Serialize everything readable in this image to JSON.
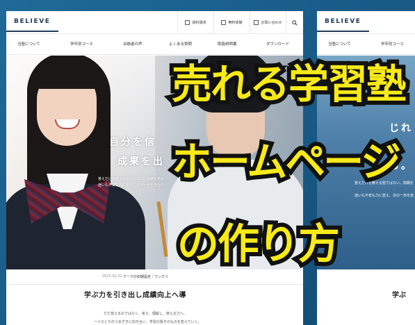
{
  "brand": {
    "logo": "BELIEVE"
  },
  "header": {
    "buttons": [
      {
        "label": "資料請求",
        "icon": "document-icon"
      },
      {
        "label": "無料体験",
        "icon": "edit-icon"
      },
      {
        "label": "お問い合わせ",
        "icon": "mail-icon"
      }
    ],
    "search_icon": "search-icon"
  },
  "nav": {
    "items": [
      "当塾について",
      "学年別コース",
      "合格者の声",
      "よくある質問",
      "取扱説明書",
      "ダウンロード"
    ]
  },
  "hero": {
    "line1": "自分を信",
    "line2": "成果を出",
    "sub1": "答えだけを教える塾ではない。成績を高め",
    "sub2": "迷いも不安も力に変え、次の一歩を自分の"
  },
  "news": {
    "date": "2023.02.21",
    "text": "テーマの初期設定｜ワンクリ"
  },
  "section": {
    "title": "学ぶ力を引き出し成績向上へ導",
    "line1": "ただ覚えるのではなく、考え、理解し、使える力へ。",
    "line2": "一人ひとりのつまずきに向き合い、学習の質そのものを変えていく。"
  },
  "window2": {
    "nav": [
      "当塾について",
      "学年別コース"
    ],
    "hero_line1": "じれ",
    "hero_line2": "る。",
    "sub1": "答えだけを教える塾ではない。挑戦を",
    "sub2": "迷いも不安も力に変え、次の一歩を自",
    "section_title": "学ぶ"
  },
  "overlay": {
    "line1": "売れる学習塾",
    "line2": "ホームページ",
    "line3": "の作り方"
  },
  "colors": {
    "overlay_fill": "#f7ea18",
    "overlay_stroke": "#111111",
    "background": "#1d5e8c",
    "logo": "#203a55"
  }
}
